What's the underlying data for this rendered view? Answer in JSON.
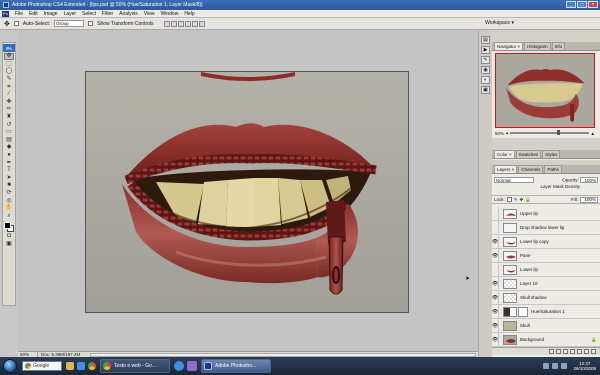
{
  "title_bar": {
    "title": "Adobe Photoshop CS4 Extended - [lips.psd @ 50% (Hue/Saturation 1, Layer Mask/8)]"
  },
  "menu": {
    "logo": "Ps",
    "items": [
      "File",
      "Edit",
      "Image",
      "Layer",
      "Select",
      "Filter",
      "Analysis",
      "View",
      "Window",
      "Help"
    ]
  },
  "options_bar": {
    "auto_select_label": "Auto-Select:",
    "auto_select_value": "Group",
    "transform_label": "Show Transform Controls",
    "workspace_label": "Workspace ▾"
  },
  "toolbox": {
    "badge": "Ps",
    "tools": [
      "move-tool-icon",
      "marquee-tool-icon",
      "lasso-tool-icon",
      "quick-select-tool-icon",
      "crop-tool-icon",
      "eyedropper-tool-icon",
      "healing-brush-tool-icon",
      "brush-tool-icon",
      "clone-stamp-tool-icon",
      "history-brush-tool-icon",
      "eraser-tool-icon",
      "gradient-tool-icon",
      "blur-tool-icon",
      "dodge-tool-icon",
      "pen-tool-icon",
      "type-tool-icon",
      "path-select-tool-icon",
      "shape-tool-icon",
      "3d-rotate-tool-icon",
      "3d-orbit-tool-icon",
      "hand-tool-icon",
      "zoom-tool-icon"
    ]
  },
  "document": {
    "zoom": "50%",
    "doc_info": "Doc: 5.36M/197.2M"
  },
  "navigator": {
    "tabs": [
      "Navigator ×",
      "Histogram",
      "Info"
    ],
    "zoom": "50%"
  },
  "color_panel": {
    "tabs": [
      "Color ×",
      "Swatches",
      "Styles"
    ]
  },
  "layers_panel": {
    "tabs": [
      "Layers ×",
      "Channels",
      "Paths"
    ],
    "blend_mode": "Normal",
    "opacity_label": "Opacity:",
    "opacity": "100%",
    "mask_density": "Layer Mask Density",
    "lock_label": "Lock:",
    "fill_label": "Fill:",
    "fill": "100%",
    "layers": [
      {
        "name": "Upper lip",
        "visible": false,
        "thumb": "lip"
      },
      {
        "name": "Drop shadow lower lip",
        "visible": false,
        "thumb": "blank"
      },
      {
        "name": "Lower lip copy",
        "visible": true,
        "thumb": "lip"
      },
      {
        "name": "Pane",
        "visible": true,
        "thumb": "lip"
      },
      {
        "name": "Lower lip",
        "visible": false,
        "thumb": "lip"
      },
      {
        "name": "Layer 10",
        "visible": true,
        "thumb": "blank"
      },
      {
        "name": "Skull shadow",
        "visible": true,
        "thumb": "blank"
      },
      {
        "name": "Hue/Saturation 1",
        "visible": true,
        "thumb": "adjust"
      },
      {
        "name": "Skull",
        "visible": true,
        "thumb": "skull"
      },
      {
        "name": "Background",
        "visible": true,
        "thumb": "photo"
      }
    ]
  },
  "taskbar": {
    "search_label": "Google",
    "tasks": [
      {
        "label": "Testo e web - Go...",
        "active": false
      },
      {
        "label": "Adobe Photosho...",
        "active": true
      }
    ],
    "clock_time": "12:47",
    "clock_date": "26/10/2009"
  },
  "colors": {
    "lip_red": "#8e2d2a",
    "zipper": "#7d2422",
    "teeth": "#d8c98f",
    "nav_highlight": "#e01010"
  }
}
